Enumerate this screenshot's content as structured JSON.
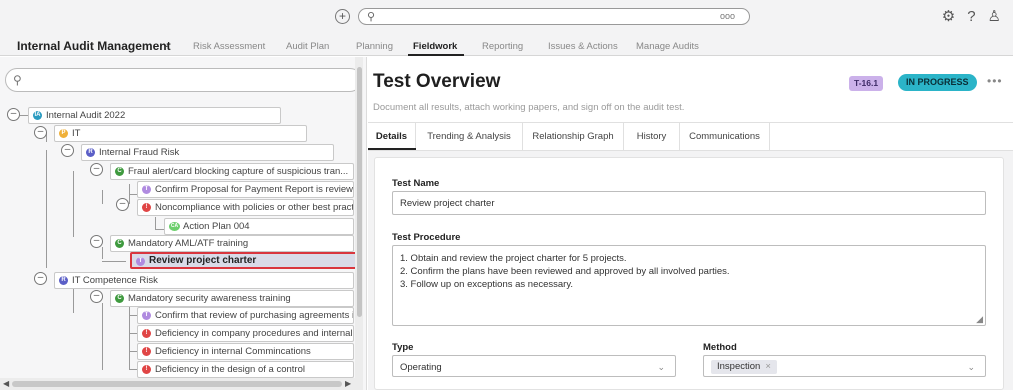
{
  "topbar": {
    "add_icon": "+",
    "search_icon": "search-icon",
    "search_more": "ooo",
    "right_icons": [
      "gear-icon",
      "help-icon",
      "user-icon"
    ]
  },
  "nav": {
    "app_name": "Internal Audit Management",
    "links": [
      "Risk Assessment",
      "Audit Plan",
      "Planning",
      "Fieldwork",
      "Reporting",
      "Issues & Actions",
      "Manage Audits"
    ],
    "active": "Fieldwork"
  },
  "tree": {
    "search_placeholder": "",
    "nodes": [
      {
        "label": "Internal Audit 2022",
        "badge": "IA",
        "color": "#2a9bc0"
      },
      {
        "label": "IT",
        "badge": "P",
        "color": "#f0b13a"
      },
      {
        "label": "Internal Fraud Risk",
        "badge": "R",
        "color": "#5b5fc7"
      },
      {
        "label": "Fraul alert/card blocking capture of suspicious tran...",
        "badge": "C",
        "color": "#3f9a3f"
      },
      {
        "label": "Confirm Proposal for Payment Report is reviewed a",
        "badge": "T",
        "color": "#b08be0"
      },
      {
        "label": "Noncompliance with policies or other best practi...",
        "badge": "!",
        "color": "#e04545"
      },
      {
        "label": "Action Plan 004",
        "badge": "CA",
        "color": "#6ccf6c"
      },
      {
        "label": "Mandatory AML/ATF training",
        "badge": "C",
        "color": "#3f9a3f"
      },
      {
        "label": "Review project charter",
        "badge": "T",
        "color": "#b08be0"
      },
      {
        "label": "IT Competence Risk",
        "badge": "R",
        "color": "#5b5fc7"
      },
      {
        "label": "Mandatory security awareness training",
        "badge": "C",
        "color": "#3f9a3f"
      },
      {
        "label": "Confirm that review of purchasing agreements is cc",
        "badge": "T",
        "color": "#b08be0"
      },
      {
        "label": "Deficiency in company procedures and internal doc",
        "badge": "!",
        "color": "#e04545"
      },
      {
        "label": "Deficiency in internal Commincations",
        "badge": "!",
        "color": "#e04545"
      },
      {
        "label": "Deficiency in the design of a control",
        "badge": "!",
        "color": "#e04545"
      }
    ]
  },
  "main": {
    "title": "Test Overview",
    "subtitle": "Document all results, attach working papers, and sign off on the audit test.",
    "id_chip": "T-16.1",
    "status": "IN PROGRESS",
    "more": "•••",
    "tabs": [
      "Details",
      "Trending & Analysis",
      "Relationship Graph",
      "History",
      "Communications"
    ],
    "test_name_label": "Test Name",
    "test_name_value": "Review project charter",
    "procedure_label": "Test Procedure",
    "procedure_lines": [
      "1. Obtain and review the project charter for 5 projects.",
      "2. Confirm the plans have been reviewed and approved by all involved parties.",
      "3. Follow up on exceptions as necessary."
    ],
    "type_label": "Type",
    "type_value": "Operating",
    "method_label": "Method",
    "method_chip": "Inspection",
    "chip_remove": "×"
  },
  "colors": {
    "selected_border": "#d9363e",
    "status_chip": "#2bb4c8",
    "id_chip": "#cbb1ea"
  }
}
